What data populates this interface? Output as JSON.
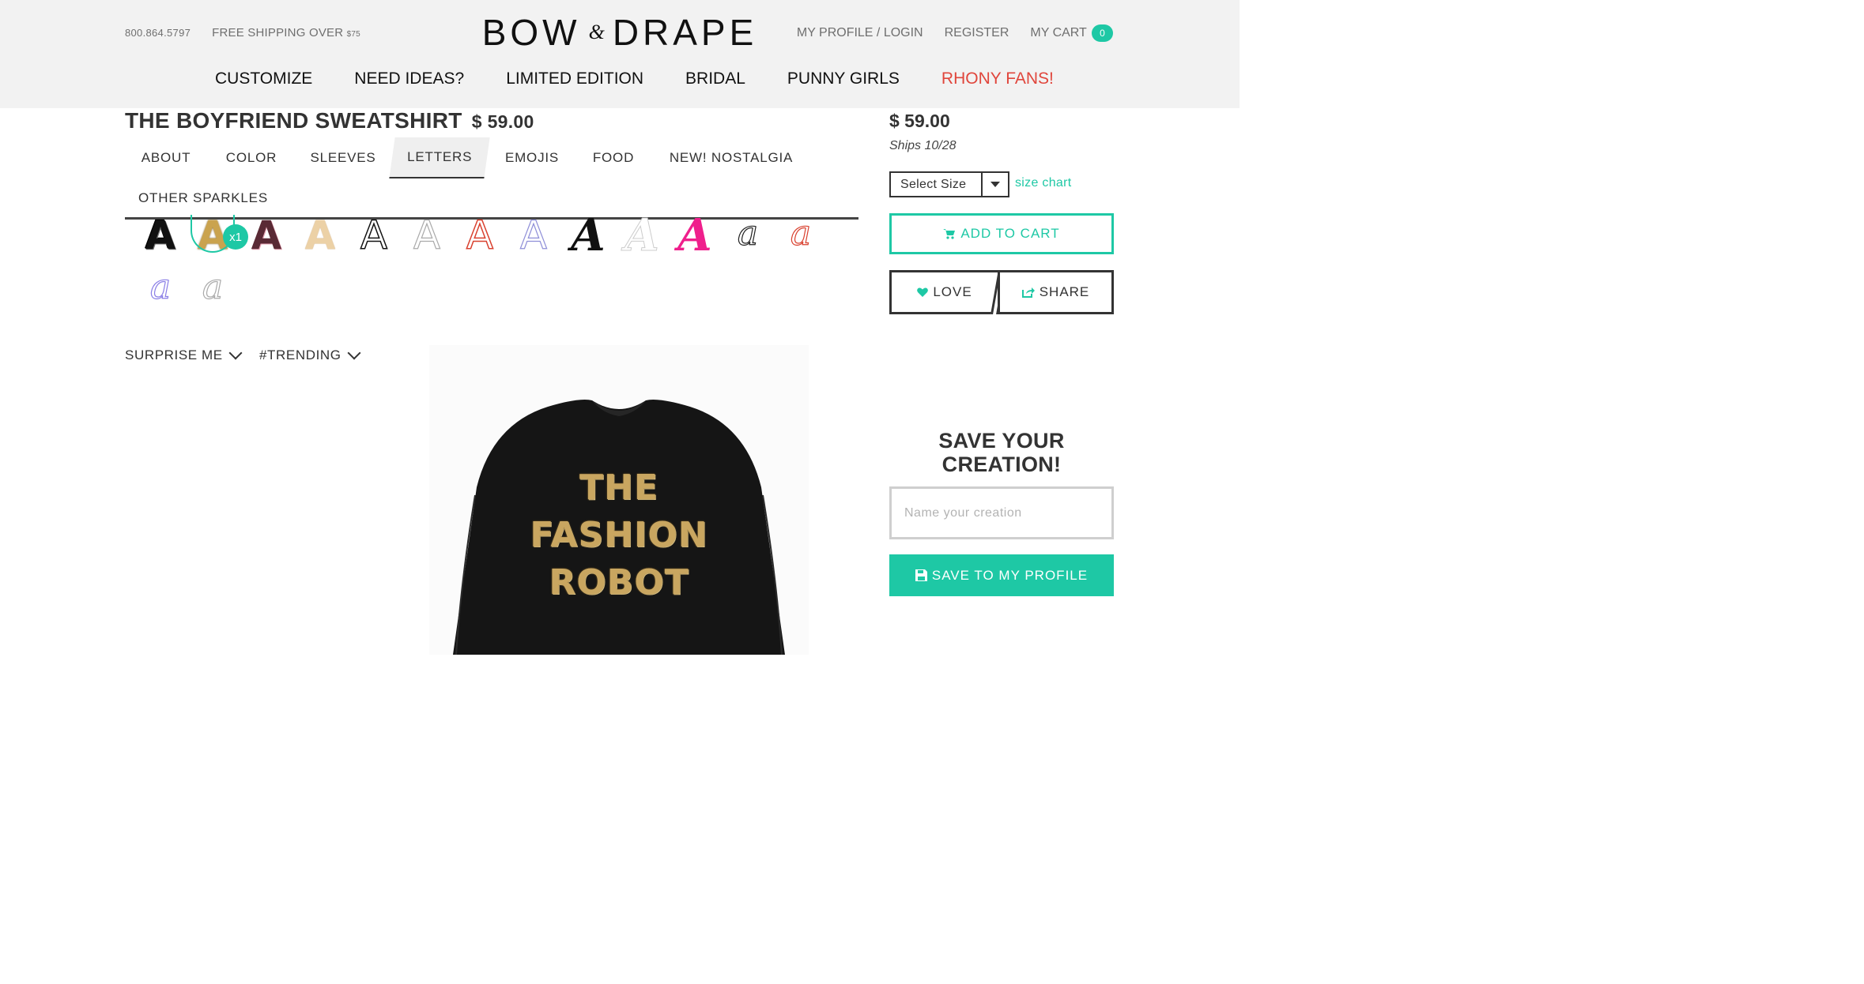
{
  "header": {
    "phone": "800.864.5797",
    "shipping_text": "FREE SHIPPING OVER",
    "shipping_amount": "$75",
    "logo_left": "BOW",
    "logo_amp": "&",
    "logo_right": "DRAPE",
    "profile_login": "MY PROFILE / LOGIN",
    "register": "REGISTER",
    "cart_label": "MY CART",
    "cart_count": "0"
  },
  "nav": {
    "items": [
      "CUSTOMIZE",
      "NEED IDEAS?",
      "LIMITED EDITION",
      "BRIDAL",
      "PUNNY GIRLS",
      "RHONY FANS!"
    ],
    "highlight_color": "#e0463c"
  },
  "product": {
    "title": "THE BOYFRIEND SWEATSHIRT",
    "price": "$ 59.00",
    "image_text_lines": [
      "THE",
      "FASHION",
      "ROBOT"
    ]
  },
  "tabs": {
    "items": [
      "ABOUT",
      "COLOR",
      "SLEEVES",
      "LETTERS",
      "EMOJIS",
      "FOOD",
      "NEW! NOSTALGIA",
      "OTHER SPARKLES"
    ],
    "active": "LETTERS"
  },
  "letters": {
    "selected_count": "x1",
    "swatches": [
      {
        "glyph": "A",
        "style": "black-sequin"
      },
      {
        "glyph": "A",
        "style": "gold-sequin"
      },
      {
        "glyph": "A",
        "style": "pink-black-sequin"
      },
      {
        "glyph": "A",
        "style": "beige-pearl"
      },
      {
        "glyph": "A",
        "style": "black-outline"
      },
      {
        "glyph": "A",
        "style": "gray-outline"
      },
      {
        "glyph": "A",
        "style": "red-outline"
      },
      {
        "glyph": "A",
        "style": "lavender-outline"
      },
      {
        "glyph": "A",
        "style": "black-bold-italic"
      },
      {
        "glyph": "A",
        "style": "white-serif"
      },
      {
        "glyph": "A",
        "style": "pink-bold-italic"
      },
      {
        "glyph": "a",
        "style": "black-dotted-script"
      },
      {
        "glyph": "a",
        "style": "red-dotted-script"
      },
      {
        "glyph": "a",
        "style": "purple-dotted-script"
      },
      {
        "glyph": "a",
        "style": "gray-dotted-script"
      }
    ]
  },
  "filters": {
    "surprise": "SURPRISE ME",
    "trending": "#TRENDING"
  },
  "sidebar": {
    "price": "$ 59.00",
    "ships": "Ships 10/28",
    "size_select": "Select Size",
    "size_chart": "size chart",
    "add_to_cart": "ADD TO CART",
    "love": "LOVE",
    "share": "SHARE",
    "save_heading_1": "SAVE YOUR",
    "save_heading_2": "CREATION!",
    "name_placeholder": "Name your creation",
    "save_button": "SAVE TO MY PROFILE"
  },
  "colors": {
    "accent": "#1ec8a5",
    "header_bg": "#f2f2f2",
    "text": "#333333"
  }
}
